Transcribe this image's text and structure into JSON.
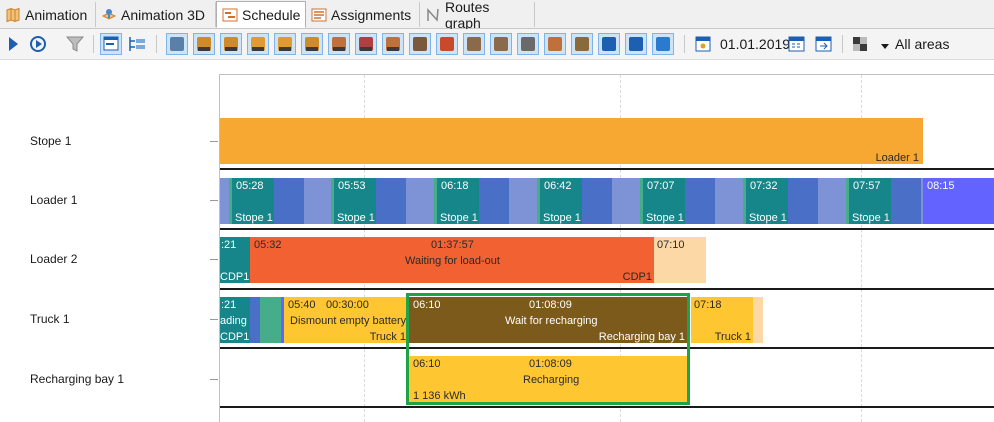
{
  "tabs": [
    {
      "label": "Animation",
      "icon": "map-icon"
    },
    {
      "label": "Animation 3D",
      "icon": "map-3d-icon"
    },
    {
      "label": "Schedule",
      "icon": "schedule-icon",
      "active": true
    },
    {
      "label": "Assignments",
      "icon": "assignments-icon"
    },
    {
      "label": "Routes graph",
      "icon": "routes-graph-icon"
    }
  ],
  "toolbar": {
    "date": "01.01.2019",
    "area_filter": "All areas"
  },
  "gantt": {
    "rows": [
      {
        "label": "Stope 1"
      },
      {
        "label": "Loader 1"
      },
      {
        "label": "Loader 2"
      },
      {
        "label": "Truck 1"
      },
      {
        "label": "Recharging bay 1"
      }
    ],
    "stope1": {
      "resource": "Loader 1"
    },
    "loader1": {
      "times": [
        "05:28",
        "05:53",
        "06:18",
        "06:42",
        "07:07",
        "07:32",
        "07:57",
        "08:15"
      ],
      "location": "Stope 1"
    },
    "loader2": {
      "left_time": ":21",
      "left_loc": "CDP1",
      "wait_start": "05:32",
      "wait_duration": "01:37:57",
      "wait_label": "Waiting for load-out",
      "wait_loc": "CDP1",
      "next_time": "07:10"
    },
    "truck1": {
      "left_time": ":21",
      "left_label": "ading",
      "left_loc": "CDP1",
      "dismount_start": "05:40",
      "dismount_duration": "00:30:00",
      "dismount_label": "Dismount empty battery",
      "dismount_loc": "Truck 1",
      "wait_start": "06:10",
      "wait_duration": "01:08:09",
      "wait_label": "Wait for recharging",
      "wait_loc": "Recharging bay 1",
      "next_time": "07:18",
      "next_loc": "Truck 1"
    },
    "recharging": {
      "start": "06:10",
      "duration": "01:08:09",
      "label": "Recharging",
      "energy": "1 136 kWh"
    }
  }
}
